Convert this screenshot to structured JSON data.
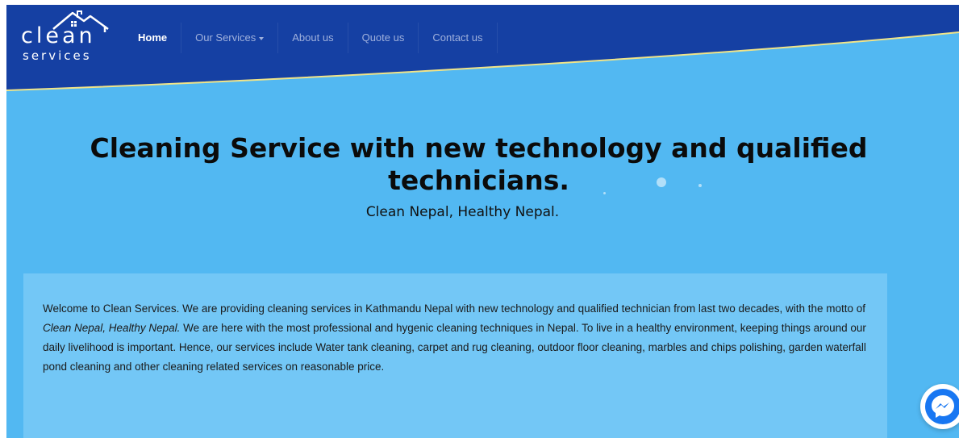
{
  "brand": {
    "logo_word": "clean",
    "logo_sub": "services"
  },
  "nav": {
    "items": [
      {
        "label": "Home",
        "active": true
      },
      {
        "label": "Our Services",
        "dropdown": true
      },
      {
        "label": "About us"
      },
      {
        "label": "Quote us"
      },
      {
        "label": "Contact us"
      }
    ]
  },
  "hero": {
    "title": "Cleaning Service with new technology and qualified technicians.",
    "subtitle": "Clean Nepal, Healthy Nepal."
  },
  "intro": {
    "part1": "Welcome to Clean Services. We are providing cleaning services in Kathmandu Nepal with new technology and qualified technician from last two decades, with the motto of ",
    "motto": "Clean Nepal, Healthy Nepal.",
    "part2": " We are here with the most professional and hygenic cleaning techniques in Nepal. To live in a healthy environment, keeping things around our daily livelihood is important. Hence, our services include Water tank cleaning, carpet and rug cleaning, outdoor floor cleaning, marbles and chips polishing, garden waterfall pond cleaning and other cleaning related services on reasonable price."
  },
  "colors": {
    "header": "#1540a3",
    "page_bg": "#52b8f2",
    "content_bg": "#73c7f6",
    "wave_edge": "#f1e488",
    "messenger": "#1877f2"
  },
  "icons": {
    "logo_roof": "house-roof-icon",
    "dropdown": "caret-down-icon",
    "chat": "messenger-icon"
  }
}
